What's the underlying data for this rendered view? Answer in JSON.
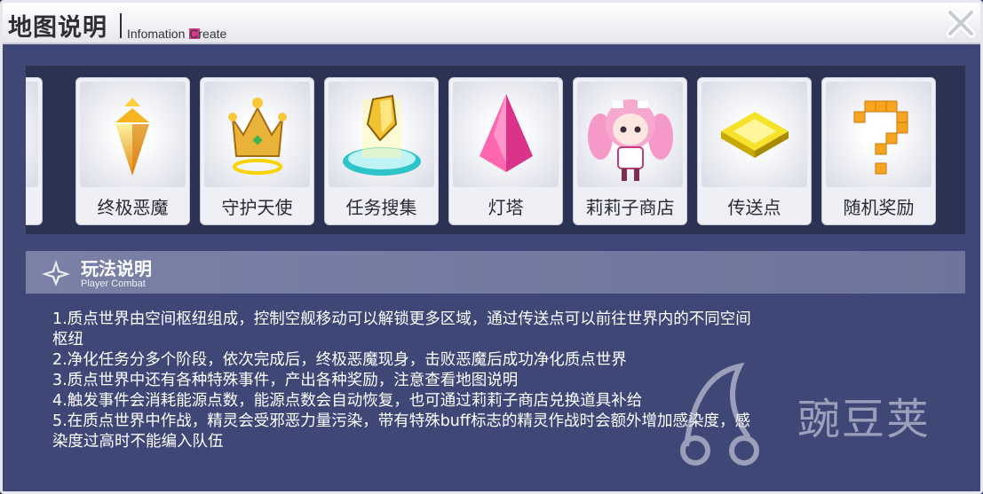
{
  "window": {
    "title": "地图说明",
    "subtitle_a": "Infomation ",
    "subtitle_b": "Create"
  },
  "cards": [
    {
      "label": "终极恶魔",
      "icon": "gold-crystal-icon"
    },
    {
      "label": "守护天使",
      "icon": "crown-icon"
    },
    {
      "label": "任务搜集",
      "icon": "quest-gem-icon"
    },
    {
      "label": "灯塔",
      "icon": "pink-crystal-icon"
    },
    {
      "label": "莉莉子商店",
      "icon": "girl-character-icon"
    },
    {
      "label": "传送点",
      "icon": "teleport-pad-icon"
    },
    {
      "label": "随机奖励",
      "icon": "question-mark-icon"
    }
  ],
  "section": {
    "title": "玩法说明",
    "subtitle": "Player Combat"
  },
  "description": [
    "1.质点世界由空间枢纽组成，控制空舰移动可以解锁更多区域，通过传送点可以前往世界内的不同空间",
    "枢纽",
    "2.净化任务分多个阶段，依次完成后，终极恶魔现身，击败恶魔后成功净化质点世界",
    "3.质点世界中还有各种特殊事件，产出各种奖励，注意查看地图说明",
    "4.触发事件会消耗能源点数，能源点数会自动恢复，也可通过莉莉子商店兑换道具补给",
    "5.在质点世界中作战，精灵会受邪恶力量污染，带有特殊buff标志的精灵作战时会额外增加感染度，感",
    "染度过高时不能编入队伍"
  ],
  "watermark": {
    "text": "豌豆荚"
  },
  "colors": {
    "panel": "#3f4777",
    "strip": "#2b3254",
    "section": "#7a80a6",
    "accent": "#d03888"
  }
}
